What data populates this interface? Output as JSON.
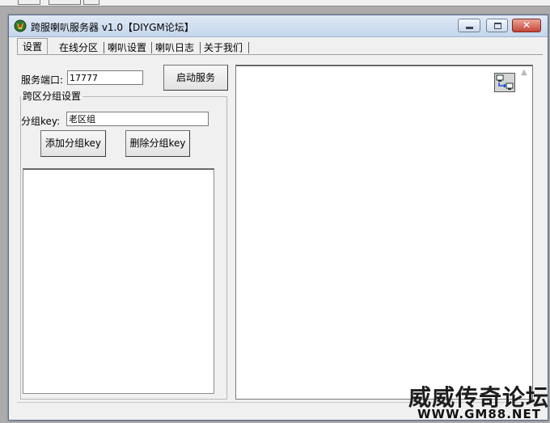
{
  "window": {
    "title": "跨服喇叭服务器 v1.0【DIYGM论坛】",
    "close_glyph": "✕"
  },
  "tabs": [
    {
      "label": "设置"
    },
    {
      "label": "在线分区"
    },
    {
      "label": "喇叭设置"
    },
    {
      "label": "喇叭日志"
    },
    {
      "label": "关于我们"
    }
  ],
  "settings": {
    "port_label": "服务端口:",
    "port_value": "17777",
    "start_button": "启动服务",
    "group_box_title": "跨区分组设置",
    "group_key_label": "分组key:",
    "group_key_value": "老区组",
    "add_button": "添加分组key",
    "delete_button": "删除分组key"
  },
  "log": {
    "scroll_up_glyph": "▲"
  },
  "watermark": {
    "line1": "威威传奇论坛",
    "line2": "WWW.GM88.NET"
  }
}
